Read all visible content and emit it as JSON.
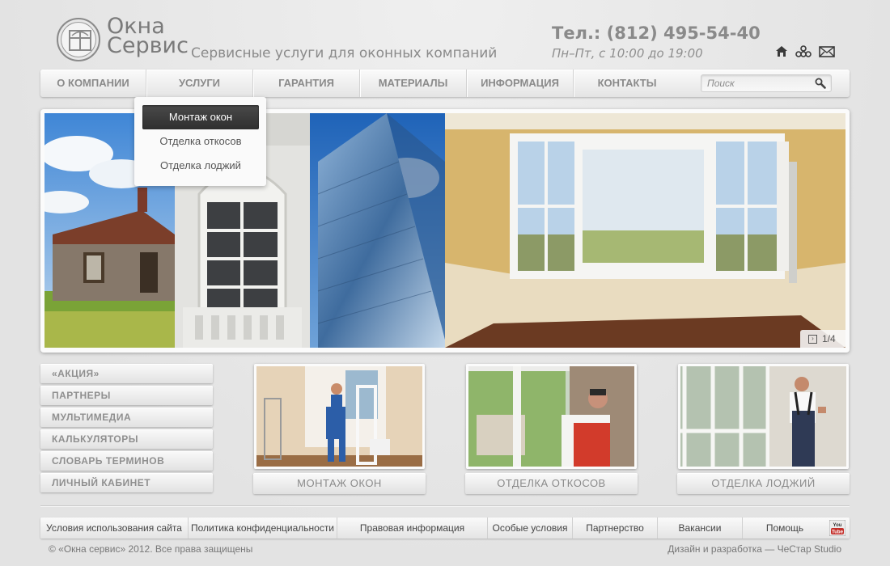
{
  "header": {
    "logo_line1": "Окна",
    "logo_line2": "Сервис",
    "tagline": "Сервисные услуги для оконных компаний",
    "phone": "Тел.: (812) 495-54-40",
    "hours": "Пн–Пт, с 10:00 до 19:00",
    "icons": [
      "home-icon",
      "sitemap-icon",
      "mail-icon"
    ]
  },
  "nav": {
    "items": [
      {
        "label": "О компании"
      },
      {
        "label": "Услуги"
      },
      {
        "label": "Гарантия"
      },
      {
        "label": "Материалы"
      },
      {
        "label": "Информация"
      },
      {
        "label": "Контакты"
      }
    ],
    "search_placeholder": "Поиск"
  },
  "dropdown": {
    "items": [
      {
        "label": "Монтаж окон",
        "active": true
      },
      {
        "label": "Отделка откосов",
        "active": false
      },
      {
        "label": "Отделка лоджий",
        "active": false
      }
    ]
  },
  "slider": {
    "counter": "1/4"
  },
  "side_menu": {
    "items": [
      {
        "label": "«Акция»"
      },
      {
        "label": "Партнеры"
      },
      {
        "label": "Мультимедиа"
      },
      {
        "label": "Калькуляторы"
      },
      {
        "label": "Словарь терминов"
      },
      {
        "label": "Личный кабинет"
      }
    ]
  },
  "cards": [
    {
      "label": "Монтаж окон"
    },
    {
      "label": "Отделка откосов"
    },
    {
      "label": "Отделка лоджий"
    }
  ],
  "footer": {
    "links": [
      {
        "label": "Условия использования сайта"
      },
      {
        "label": "Политика конфиденциальности"
      },
      {
        "label": "Правовая информация"
      },
      {
        "label": "Особые условия"
      },
      {
        "label": "Партнерство"
      },
      {
        "label": "Вакансии"
      },
      {
        "label": "Помощь"
      }
    ],
    "youtube_label": "You Tube",
    "copyright": "© «Окна сервис» 2012. Все права защищены",
    "developer": "Дизайн и разработка — ЧеСтар Studio"
  },
  "colors": {
    "background": "#e6e6e6",
    "text": "#8a8a8a",
    "dropdown_active": "#3a3a3a",
    "youtube_red": "#c4302b"
  }
}
